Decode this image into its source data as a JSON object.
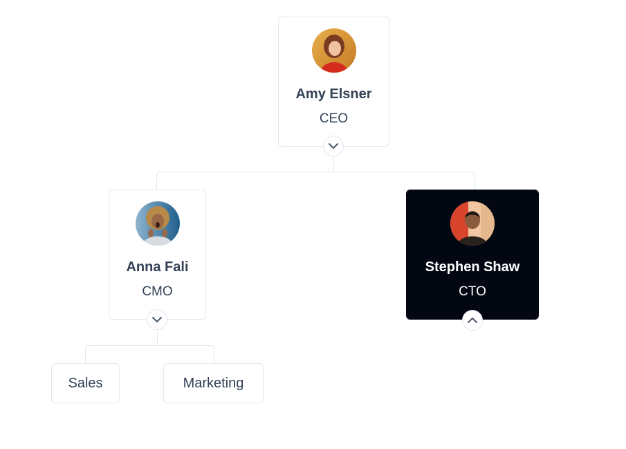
{
  "root": {
    "name": "Amy Elsner",
    "title": "CEO",
    "toggle_icon": "chevron-down-icon"
  },
  "children": [
    {
      "name": "Anna Fali",
      "title": "CMO",
      "toggle_icon": "chevron-down-icon",
      "departments": [
        {
          "label": "Sales"
        },
        {
          "label": "Marketing"
        }
      ]
    },
    {
      "name": "Stephen Shaw",
      "title": "CTO",
      "selected": true,
      "toggle_icon": "chevron-up-icon"
    }
  ],
  "colors": {
    "border": "#e2e8f0",
    "text": "#334155",
    "selected_bg": "#030712",
    "selected_text": "#ffffff",
    "chevron": "#475569"
  }
}
